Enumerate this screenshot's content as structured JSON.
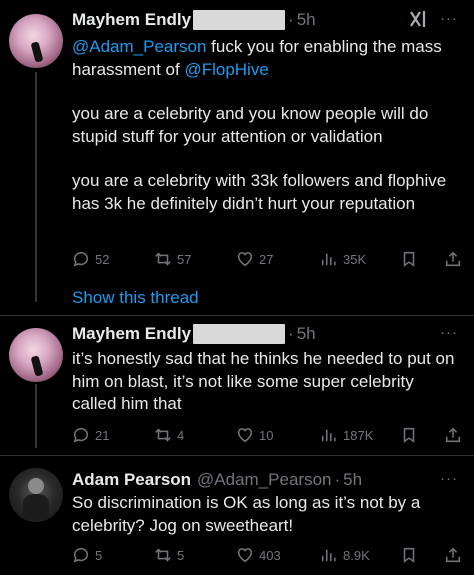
{
  "tweets": [
    {
      "name": "Mayhem Endly",
      "time": "5h",
      "handle": "",
      "text": [
        "@Adam_Pearson fuck you for enabling the mass harassment of @FlopHive",
        "you are a celebrity and you know people will do stupid stuff for your attention or validation",
        "you are a celebrity with 33k followers and flophive has 3k he definitely didn’t hurt your reputation"
      ],
      "mention1": "@Adam_Pearson",
      "text1_rest": " fuck you for enabling the mass harassment of ",
      "mention2": "@FlopHive",
      "replies": "52",
      "retweets": "57",
      "likes": "27",
      "views": "35K"
    },
    {
      "name": "Mayhem Endly",
      "time": "5h",
      "text": "it’s honestly sad that he thinks he needed to put on him on blast, it’s not like some super celebrity called him that",
      "replies": "21",
      "retweets": "4",
      "likes": "10",
      "views": "187K"
    },
    {
      "name": "Adam Pearson",
      "handle": "@Adam_Pearson",
      "time": "5h",
      "text": "So discrimination is OK as long as it’s not by a celebrity? Jog on sweetheart!",
      "replies": "5",
      "retweets": "5",
      "likes": "403",
      "views": "8.9K"
    }
  ],
  "show_thread": "Show this thread",
  "more_label": "···",
  "xai_label": "x⁄"
}
